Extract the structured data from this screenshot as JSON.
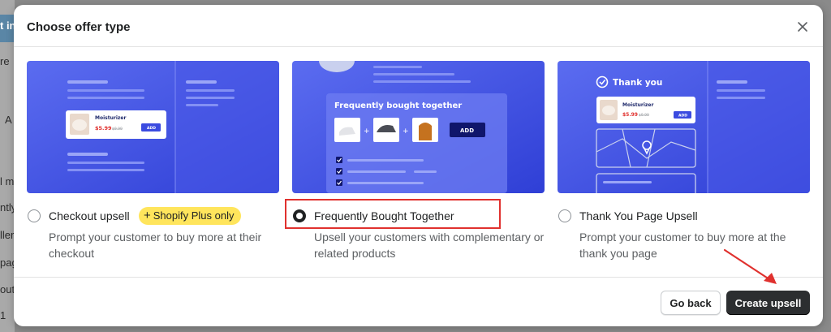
{
  "background_fragments": [
    "t in",
    "re",
    "A",
    "l m",
    "ntly",
    "ller",
    "pag",
    "out",
    "1"
  ],
  "modal": {
    "title": "Choose offer type",
    "close_icon": "close-icon"
  },
  "cards": [
    {
      "illustration": {
        "product_name": "Moisturizer",
        "price": "$5.99",
        "old_price": "$9.99",
        "add_label": "ADD"
      },
      "title": "Checkout upsell",
      "badge": "Shopify Plus only",
      "description": "Prompt your customer to buy more at their checkout",
      "selected": false
    },
    {
      "illustration": {
        "heading": "Frequently bought together",
        "add_label": "ADD"
      },
      "title": "Frequently Bought Together",
      "description": "Upsell your customers with complementary or related products",
      "selected": true
    },
    {
      "illustration": {
        "heading": "Thank you",
        "product_name": "Moisturizer",
        "price": "$5.99",
        "old_price": "$9.99",
        "add_label": "ADD"
      },
      "title": "Thank You Page Upsell",
      "description": "Prompt your customer to buy more at the thank you page",
      "selected": false
    }
  ],
  "footer": {
    "back_label": "Go back",
    "create_label": "Create upsell"
  },
  "colors": {
    "card_gradient_start": "#5b6cf0",
    "card_gradient_end": "#2f3fd6",
    "highlight": "#e0312e",
    "primary_button": "#2c2e30",
    "badge": "#ffe55c"
  }
}
